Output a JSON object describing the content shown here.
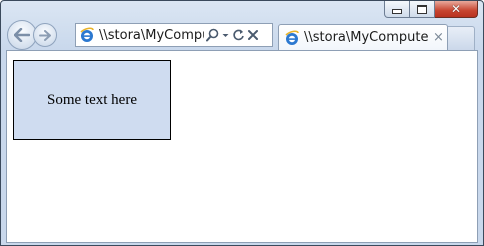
{
  "window": {
    "controls": {
      "minimize_icon": "minimize-icon",
      "maximize_icon": "maximize-icon",
      "close_icon": "close-icon"
    }
  },
  "nav": {
    "back_icon": "back-arrow-icon",
    "forward_icon": "forward-arrow-icon"
  },
  "address_bar": {
    "url": "\\\\stora\\MyComput",
    "icons": [
      "ie-page-icon",
      "search-icon",
      "dropdown-chevron-icon",
      "refresh-icon",
      "stop-icon"
    ]
  },
  "tab": {
    "title": "\\\\stora\\MyComputers...",
    "close_glyph": "×"
  },
  "page": {
    "box_text": "Some text here"
  },
  "colors": {
    "box_fill": "#cfdcf0",
    "chrome": "#c9d8ec",
    "close_button": "#c7442f"
  }
}
